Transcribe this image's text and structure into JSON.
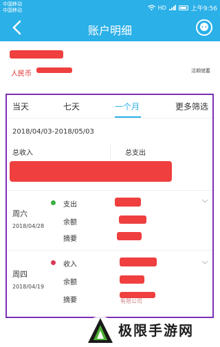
{
  "status_bar": {
    "carrier_1": "中国移动",
    "carrier_2": "中国移动",
    "net_label": "HD",
    "time": "上午9:56"
  },
  "header": {
    "title": "账户明细",
    "back_icon": "chevron-left-icon",
    "support_icon": "customer-service-icon"
  },
  "account": {
    "currency_label": "人民币",
    "account_type": "活期储蓄"
  },
  "tabs": [
    {
      "label": "当天",
      "active": false
    },
    {
      "label": "七天",
      "active": false
    },
    {
      "label": "一个月",
      "active": true
    },
    {
      "label": "更多筛选",
      "active": false
    }
  ],
  "date_range": "2018/04/03-2018/05/03",
  "summary": {
    "income_label": "总收入",
    "expense_label": "总支出"
  },
  "transactions": [
    {
      "weekday": "周六",
      "date": "2018/04/28",
      "type": "支出",
      "dot_color": "#3cb043",
      "balance_label": "余额",
      "memo_label": "摘要"
    },
    {
      "weekday": "周四",
      "date": "2018/04/19",
      "type": "收入",
      "dot_color": "#d93856",
      "balance_label": "余额",
      "memo_label": "摘要",
      "memo_partial": "有限公司"
    }
  ],
  "watermark": {
    "text": "极限手游网"
  },
  "colors": {
    "primary": "#2bb0e8",
    "highlight_border": "#7b2fb3",
    "redaction": "#ef3f3f"
  }
}
